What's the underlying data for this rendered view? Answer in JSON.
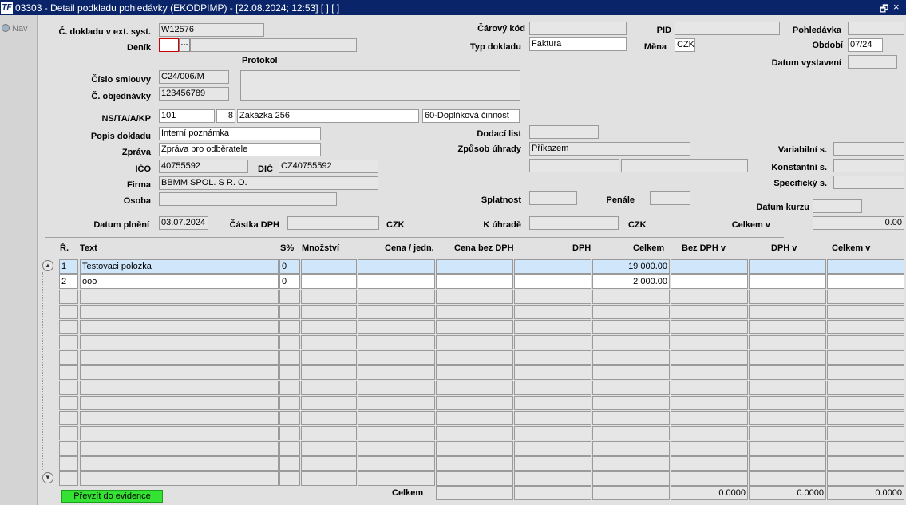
{
  "window": {
    "title": "03303 - Detail podkladu pohledávky (EKODPIMP) - [22.08.2024; 12:53]  [ ]  [ ]",
    "app_icon": "TF",
    "restore_symbol": "🗗",
    "close_symbol": "×"
  },
  "nav": {
    "label": "Nav"
  },
  "form": {
    "doklad_ext": {
      "label": "Č. dokladu v ext. syst.",
      "value": "W12576"
    },
    "denik": {
      "label": "Deník",
      "value": "",
      "lookup": "...",
      "desc": ""
    },
    "protokol": {
      "label": "Protokol",
      "value": ""
    },
    "smlouva": {
      "label": "Číslo smlouvy",
      "value": "C24/006/M"
    },
    "objednavka": {
      "label": "Č. objednávky",
      "value": "123456789"
    },
    "ns": {
      "label": "NS/TA/A/KP",
      "v1": "101",
      "v2": "8",
      "v3": "Zakázka 256",
      "v4": "60-Doplňková činnost"
    },
    "popis": {
      "label": "Popis dokladu",
      "value": "Interní poznámka"
    },
    "zprava": {
      "label": "Zpráva",
      "value": "Zpráva pro odběratele"
    },
    "ico": {
      "label": "IČO",
      "value": "40755592"
    },
    "dic": {
      "label": "DIČ",
      "value": "CZ40755592"
    },
    "firma": {
      "label": "Firma",
      "value": "BBMM SPOL. S R. O."
    },
    "osoba": {
      "label": "Osoba",
      "value": ""
    },
    "datum_plneni": {
      "label": "Datum plnění",
      "value": "03.07.2024"
    },
    "castka_dph": {
      "label": "Částka DPH",
      "value": "",
      "currency": "CZK"
    },
    "carovy_kod": {
      "label": "Čárový kód",
      "value": ""
    },
    "typ_dokladu": {
      "label": "Typ dokladu",
      "value": "Faktura"
    },
    "dodaci_list": {
      "label": "Dodací list",
      "value": ""
    },
    "zpusob_uhrady": {
      "label": "Způsob úhrady",
      "value": "Příkazem"
    },
    "extra1": "",
    "extra2": "",
    "splatnost": {
      "label": "Splatnost",
      "value": ""
    },
    "penale": {
      "label": "Penále",
      "value": ""
    },
    "k_uhrade": {
      "label": "K úhradě",
      "value": "",
      "currency": "CZK"
    },
    "pid": {
      "label": "PID",
      "value": ""
    },
    "mena": {
      "label": "Měna",
      "value": "CZK"
    },
    "pohledavka": {
      "label": "Pohledávka",
      "value": ""
    },
    "obdobi": {
      "label": "Období",
      "value": "07/24"
    },
    "datum_vystaveni": {
      "label": "Datum vystavení",
      "value": ""
    },
    "variabilni": {
      "label": "Variabilní s.",
      "value": ""
    },
    "konstantni": {
      "label": "Konstantní s.",
      "value": ""
    },
    "specificky": {
      "label": "Specifický s.",
      "value": ""
    },
    "datum_kurzu": {
      "label": "Datum kurzu",
      "value": ""
    },
    "celkem_v": {
      "label": "Celkem v",
      "value": "0.00"
    }
  },
  "table": {
    "headers": [
      "Ř.",
      "Text",
      "S%",
      "Množství",
      "Cena / jedn.",
      "Cena bez DPH",
      "DPH",
      "Celkem",
      "Bez DPH v",
      "DPH v",
      "Celkem v"
    ],
    "rows": [
      {
        "n": "1",
        "text": "Testovaci polozka",
        "s": "0",
        "mnozstvi": "",
        "cena_jedn": "",
        "cena_bez": "",
        "dph": "",
        "celkem": "19 000.00",
        "bez_dph_v": "",
        "dph_v": "",
        "celkem_v": ""
      },
      {
        "n": "2",
        "text": "ooo",
        "s": "0",
        "mnozstvi": "",
        "cena_jedn": "",
        "cena_bez": "",
        "dph": "",
        "celkem": "2 000.00",
        "bez_dph_v": "",
        "dph_v": "",
        "celkem_v": ""
      },
      {
        "n": "",
        "text": "",
        "s": "",
        "mnozstvi": "",
        "cena_jedn": "",
        "cena_bez": "",
        "dph": "",
        "celkem": "",
        "bez_dph_v": "",
        "dph_v": "",
        "celkem_v": ""
      },
      {
        "n": "",
        "text": "",
        "s": "",
        "mnozstvi": "",
        "cena_jedn": "",
        "cena_bez": "",
        "dph": "",
        "celkem": "",
        "bez_dph_v": "",
        "dph_v": "",
        "celkem_v": ""
      },
      {
        "n": "",
        "text": "",
        "s": "",
        "mnozstvi": "",
        "cena_jedn": "",
        "cena_bez": "",
        "dph": "",
        "celkem": "",
        "bez_dph_v": "",
        "dph_v": "",
        "celkem_v": ""
      },
      {
        "n": "",
        "text": "",
        "s": "",
        "mnozstvi": "",
        "cena_jedn": "",
        "cena_bez": "",
        "dph": "",
        "celkem": "",
        "bez_dph_v": "",
        "dph_v": "",
        "celkem_v": ""
      },
      {
        "n": "",
        "text": "",
        "s": "",
        "mnozstvi": "",
        "cena_jedn": "",
        "cena_bez": "",
        "dph": "",
        "celkem": "",
        "bez_dph_v": "",
        "dph_v": "",
        "celkem_v": ""
      },
      {
        "n": "",
        "text": "",
        "s": "",
        "mnozstvi": "",
        "cena_jedn": "",
        "cena_bez": "",
        "dph": "",
        "celkem": "",
        "bez_dph_v": "",
        "dph_v": "",
        "celkem_v": ""
      },
      {
        "n": "",
        "text": "",
        "s": "",
        "mnozstvi": "",
        "cena_jedn": "",
        "cena_bez": "",
        "dph": "",
        "celkem": "",
        "bez_dph_v": "",
        "dph_v": "",
        "celkem_v": ""
      },
      {
        "n": "",
        "text": "",
        "s": "",
        "mnozstvi": "",
        "cena_jedn": "",
        "cena_bez": "",
        "dph": "",
        "celkem": "",
        "bez_dph_v": "",
        "dph_v": "",
        "celkem_v": ""
      },
      {
        "n": "",
        "text": "",
        "s": "",
        "mnozstvi": "",
        "cena_jedn": "",
        "cena_bez": "",
        "dph": "",
        "celkem": "",
        "bez_dph_v": "",
        "dph_v": "",
        "celkem_v": ""
      },
      {
        "n": "",
        "text": "",
        "s": "",
        "mnozstvi": "",
        "cena_jedn": "",
        "cena_bez": "",
        "dph": "",
        "celkem": "",
        "bez_dph_v": "",
        "dph_v": "",
        "celkem_v": ""
      },
      {
        "n": "",
        "text": "",
        "s": "",
        "mnozstvi": "",
        "cena_jedn": "",
        "cena_bez": "",
        "dph": "",
        "celkem": "",
        "bez_dph_v": "",
        "dph_v": "",
        "celkem_v": ""
      },
      {
        "n": "",
        "text": "",
        "s": "",
        "mnozstvi": "",
        "cena_jedn": "",
        "cena_bez": "",
        "dph": "",
        "celkem": "",
        "bez_dph_v": "",
        "dph_v": "",
        "celkem_v": ""
      },
      {
        "n": "",
        "text": "",
        "s": "",
        "mnozstvi": "",
        "cena_jedn": "",
        "cena_bez": "",
        "dph": "",
        "celkem": "",
        "bez_dph_v": "",
        "dph_v": "",
        "celkem_v": ""
      }
    ],
    "scroll_up": "▲",
    "scroll_down": "▼"
  },
  "footer": {
    "button": "Převzít do evidence",
    "total_label": "Celkem",
    "totals": [
      "",
      "",
      "",
      "0.0000",
      "0.0000",
      "0.0000"
    ]
  },
  "colors": {
    "titlebar": "#0a246a",
    "green_button": "#33e233",
    "selected_row": "#cfe6fb",
    "required_field_border": "#d00000"
  }
}
